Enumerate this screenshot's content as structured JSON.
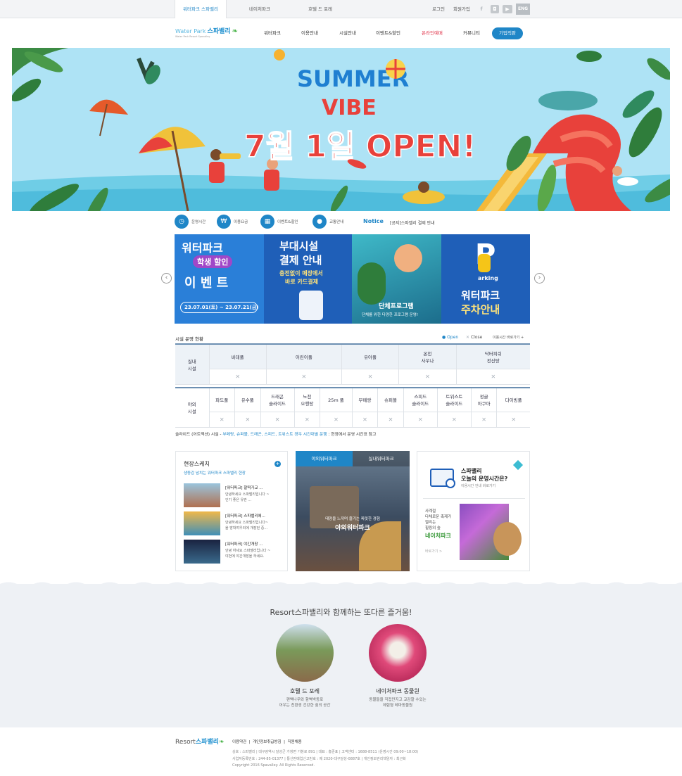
{
  "util": {
    "sites": [
      "워터파크 스파밸리",
      "네이처파크",
      "호텔 드 포레"
    ],
    "login": "로그인",
    "join": "회원가입",
    "sns": [
      "f-icon",
      "instagram-icon",
      "youtube-icon"
    ],
    "lang": "ENG"
  },
  "gnb": {
    "logo_en": "Water Park",
    "logo_ko": "스파밸리",
    "logo_sub": "Water Park Resort Spavalley",
    "menus": [
      "워터파크",
      "이용안내",
      "시설안내",
      "이벤트&할인",
      "온라인예매",
      "커뮤니티"
    ],
    "biz": "기업직판"
  },
  "hero": {
    "line1": "SUMMER",
    "line2": "VIBE",
    "line3": "7월 1일 OPEN!",
    "accent": "#e8413b",
    "blue": "#1f7fd1"
  },
  "quick": {
    "items": [
      "운영시간",
      "이용요금",
      "이벤트&할인",
      "교통안내"
    ],
    "notice_label": "Notice",
    "notice_text": "[공지]스파밸리 결제 안내"
  },
  "slides": [
    {
      "t1": "워터파크",
      "t2": "학생 할인",
      "t3": "이 벤 트",
      "t4": "23.07.01(토) ~ 23.07.21(금)"
    },
    {
      "t1": "부대시설",
      "t2": "결제 안내",
      "t3": "충전없이 매장에서",
      "t4": "바로 카드결제"
    },
    {
      "t1": "단체프로그램",
      "t2": "단체를 위한 다양한 프로그램 운영!"
    },
    {
      "t1": "arking",
      "t2": "워터파크",
      "t3": "주차안내"
    }
  ],
  "facility": {
    "title": "시설 운영 현황",
    "open": "Open",
    "close": "Close",
    "more": "이용시간 바로가기 +",
    "indoor_label": "실내\n시설",
    "indoor": [
      "바데풀",
      "어린이풀",
      "유아풀",
      "온천\n사우나",
      "닥터피쉬\n전신탕"
    ],
    "outdoor_label": "야외\n시설",
    "outdoor": [
      "파도풀",
      "유수풀",
      "드래곤\n슬라이드",
      "노천\n오행탕",
      "25m 풀",
      "부메랑",
      "슈퍼볼",
      "스피드\n슬라이드",
      "트위스트\n슬라이드",
      "정글\n아쿠아",
      "다이빙풀"
    ],
    "status": "✕",
    "note_pre": "슬라이드 (어트랙션) 시설 - ",
    "note_blue": "부메랑, 슈퍼볼, 드래곤, 스피드, 트위스트 경우 시간대별 운행",
    "note_post": " : 현장에서 운영 시간표 참고"
  },
  "sketch": {
    "title": "현장스케치",
    "sub": "생동감 넘치는 워터파크 스파밸리 현장",
    "items": [
      {
        "t": "[워터파크] 찰떡가교 ...",
        "d1": "안녕하세요 스파밸리입니다 ~",
        "d2": "인기 좋은 유관 ..."
      },
      {
        "t": "[워터파크] 스파밸리에...",
        "d1": "안녕하세요 스파밸리입니다~",
        "d2": "올 방학여우리에 개장된 중..."
      },
      {
        "t": "[워터파크] 야간개장 ...",
        "d1": "안녕 하세요 스파밸리입니다 ~",
        "d2": "야번에 야간개장을 하세요."
      }
    ]
  },
  "video": {
    "tabs": [
      "야외워터파크",
      "실내워터파크"
    ],
    "cap1": "태양을 느끼며 즐기는 짜릿한 경험",
    "cap2": "야외워터파크"
  },
  "hours": {
    "t1": "스파밸리",
    "t2": "오늘의 운영시간은?",
    "t3": "이용시간 안내 바로가기",
    "d1": "사계절",
    "d2": "다채로운 축제가",
    "d3": "열리는",
    "d4": "힐링의 숲",
    "d5": "네이처파크",
    "more": "바로가기 >"
  },
  "fun": {
    "title": "Resort스파밸리와 함께하는 또다른 즐거움!",
    "items": [
      {
        "t": "호텔 드 포레",
        "d1": "편백나무와 함벽박동로",
        "d2": "어우는 친환경 건강한 쉼의 공간"
      },
      {
        "t": "네이처파크 동물원",
        "d1": "동물들을 직접만지고 교감할 수있는",
        "d2": "체험형 테마동물원"
      }
    ]
  },
  "footer": {
    "logo_pre": "Resort",
    "logo": "스파밸리",
    "links": [
      "이용약관",
      "개인정보취급방침",
      "직원채용"
    ],
    "info1": "상호 : 스파밸리 | 대구광역시 달성군 가창면 가창로 891 | 대표 : 홍준표 | 고객센터 : 1688-8511 (운영시간 09:00~18:00)",
    "info2": "사업자등록번호 : 244-85-01377 | 통신판매업신고번호 : 제 2020-대구달성-0887호 | 개인정보관리책임자 : 최근화",
    "info3": "Copyright 2016 Spavalley. All Rights Reserved."
  }
}
